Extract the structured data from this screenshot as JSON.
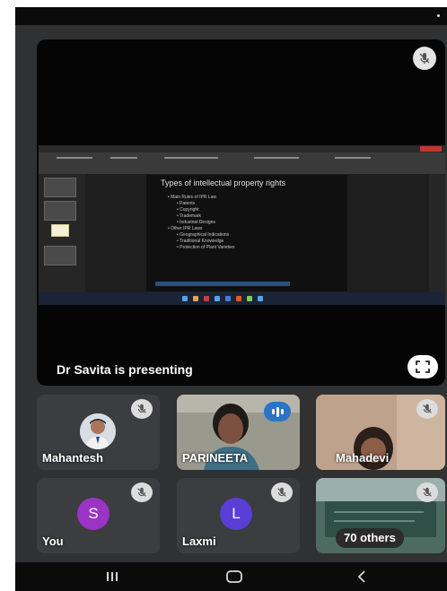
{
  "main_stage": {
    "presenter_label": "Dr Savita is presenting",
    "slide": {
      "title": "Types of intellectual property rights",
      "lines": [
        {
          "level": 1,
          "text": "• Main Rules of IPR Law"
        },
        {
          "level": 2,
          "text": "• Patents"
        },
        {
          "level": 2,
          "text": "• Copyright"
        },
        {
          "level": 2,
          "text": "• Trademark"
        },
        {
          "level": 2,
          "text": "• Industrial Designs"
        },
        {
          "level": 1,
          "text": "• Other IPR Laws"
        },
        {
          "level": 2,
          "text": "• Geographical Indications"
        },
        {
          "level": 2,
          "text": "• Traditional Knowledge"
        },
        {
          "level": 2,
          "text": "• Protection of Plant Varieties"
        }
      ]
    }
  },
  "participants": [
    {
      "name": "Mahantesh",
      "muted": true,
      "type": "photo"
    },
    {
      "name": "PARINEETA",
      "speaking": true,
      "type": "video"
    },
    {
      "name": "Mahadevi",
      "muted": true,
      "type": "video"
    },
    {
      "name": "You",
      "muted": true,
      "type": "avatar",
      "initial": "S",
      "avatar_color": "#9a34c4"
    },
    {
      "name": "Laxmi",
      "muted": true,
      "type": "avatar",
      "initial": "L",
      "avatar_color": "#5a3fd6"
    },
    {
      "overflow_label": "70 others",
      "muted": true,
      "type": "video"
    }
  ],
  "system_nav": {
    "recents_icon": "recents-icon",
    "home_icon": "home-icon",
    "back_icon": "back-icon"
  },
  "colors": {
    "background": "#303133",
    "tile": "#3c3d40",
    "speaking_indicator": "#2a73c9"
  }
}
